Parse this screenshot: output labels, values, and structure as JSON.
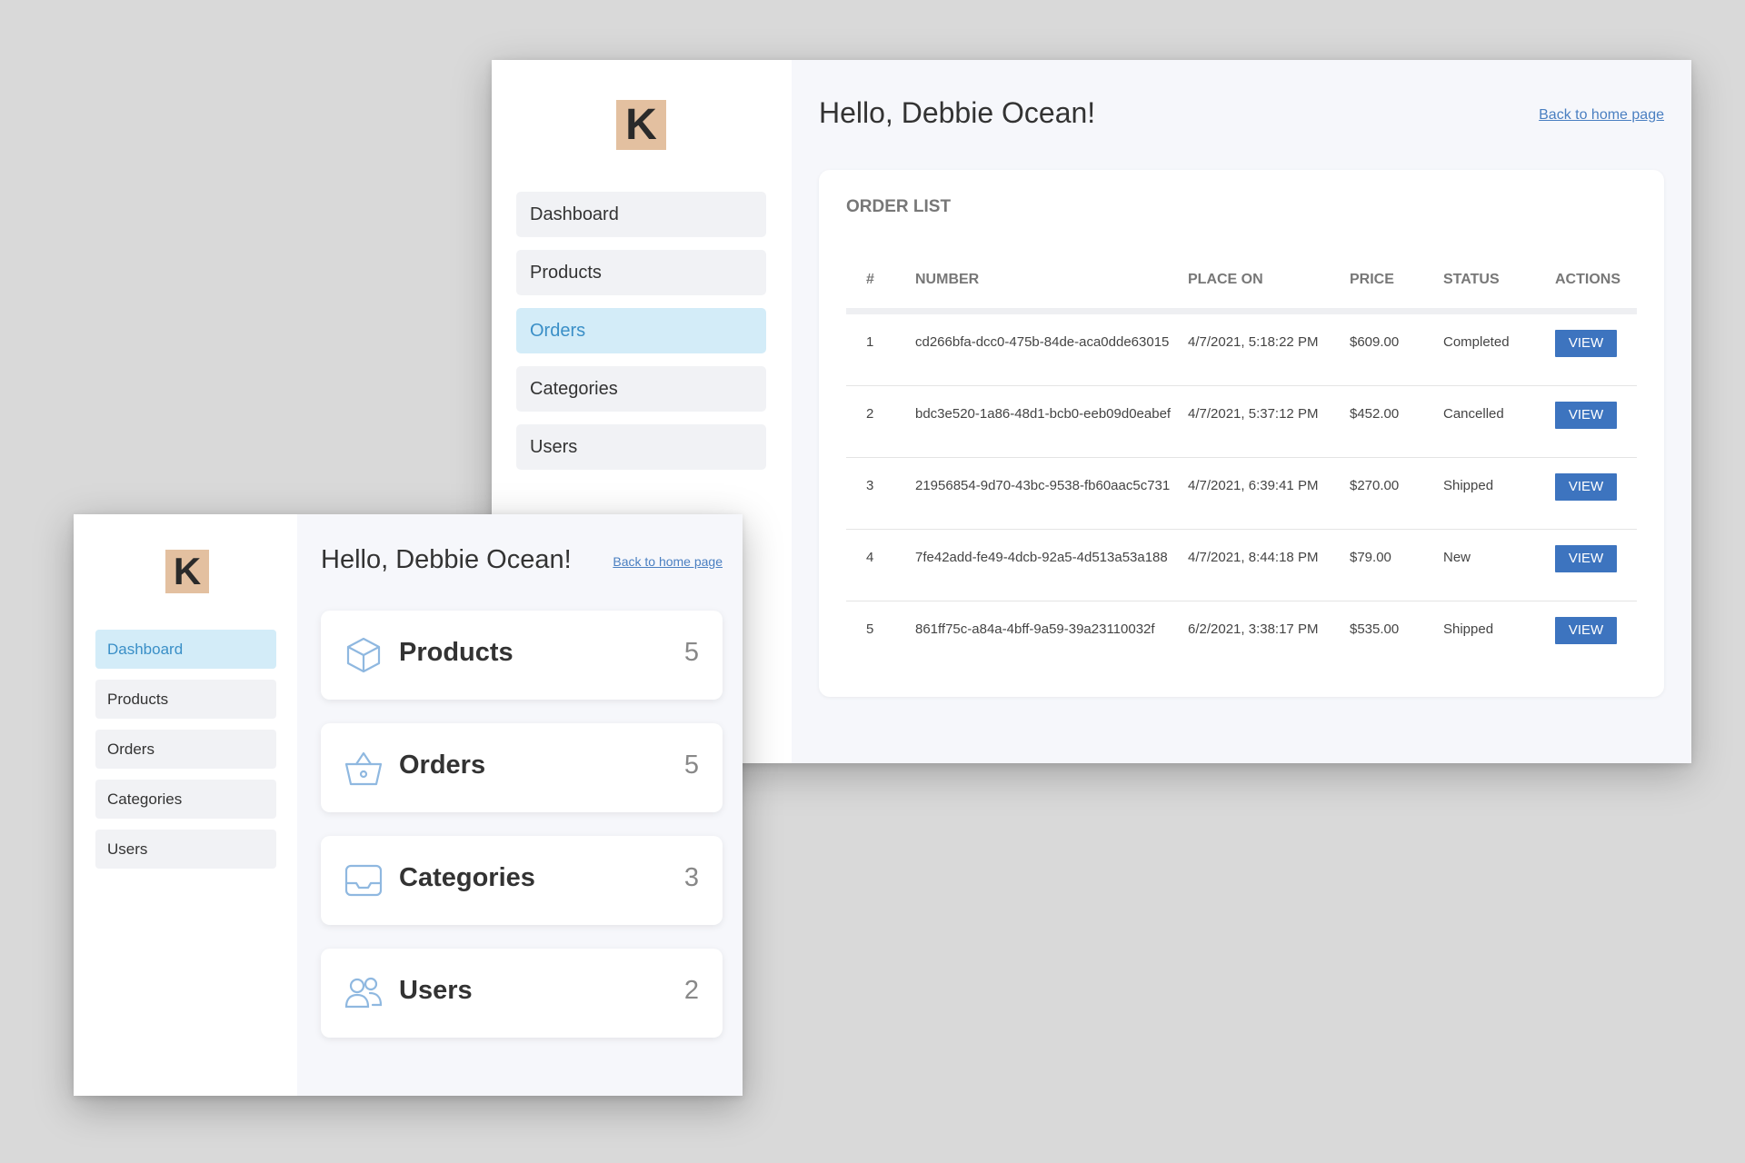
{
  "orders_window": {
    "logo": "K",
    "nav": [
      {
        "label": "Dashboard",
        "active": false
      },
      {
        "label": "Products",
        "active": false
      },
      {
        "label": "Orders",
        "active": true
      },
      {
        "label": "Categories",
        "active": false
      },
      {
        "label": "Users",
        "active": false
      }
    ],
    "greeting": "Hello, Debbie Ocean!",
    "back_link": "Back to home page",
    "card_title": "ORDER LIST",
    "columns": [
      "#",
      "NUMBER",
      "PLACE ON",
      "PRICE",
      "STATUS",
      "ACTIONS"
    ],
    "rows": [
      {
        "idx": "1",
        "number": "cd266bfa-dcc0-475b-84de-aca0dde63015",
        "placed": "4/7/2021, 5:18:22 PM",
        "price": "$609.00",
        "status": "Completed",
        "action": "VIEW"
      },
      {
        "idx": "2",
        "number": "bdc3e520-1a86-48d1-bcb0-eeb09d0eabef",
        "placed": "4/7/2021, 5:37:12 PM",
        "price": "$452.00",
        "status": "Cancelled",
        "action": "VIEW"
      },
      {
        "idx": "3",
        "number": "21956854-9d70-43bc-9538-fb60aac5c731",
        "placed": "4/7/2021, 6:39:41 PM",
        "price": "$270.00",
        "status": "Shipped",
        "action": "VIEW"
      },
      {
        "idx": "4",
        "number": "7fe42add-fe49-4dcb-92a5-4d513a53a188",
        "placed": "4/7/2021, 8:44:18 PM",
        "price": "$79.00",
        "status": "New",
        "action": "VIEW"
      },
      {
        "idx": "5",
        "number": "861ff75c-a84a-4bff-9a59-39a23110032f",
        "placed": "6/2/2021, 3:38:17 PM",
        "price": "$535.00",
        "status": "Shipped",
        "action": "VIEW"
      }
    ]
  },
  "dashboard_window": {
    "logo": "K",
    "nav": [
      {
        "label": "Dashboard",
        "active": true
      },
      {
        "label": "Products",
        "active": false
      },
      {
        "label": "Orders",
        "active": false
      },
      {
        "label": "Categories",
        "active": false
      },
      {
        "label": "Users",
        "active": false
      }
    ],
    "greeting": "Hello, Debbie Ocean!",
    "back_link": "Back to home page",
    "stats": [
      {
        "label": "Products",
        "count": "5",
        "icon": "cube-icon"
      },
      {
        "label": "Orders",
        "count": "5",
        "icon": "basket-icon"
      },
      {
        "label": "Categories",
        "count": "3",
        "icon": "inbox-icon"
      },
      {
        "label": "Users",
        "count": "2",
        "icon": "users-icon"
      }
    ]
  },
  "colors": {
    "accent": "#3d74bf",
    "active_nav_bg": "#d3ecf8",
    "active_nav_text": "#3a8fc7",
    "logo_bg": "#e3c0a0",
    "icon_stroke": "#8fb8e0"
  }
}
